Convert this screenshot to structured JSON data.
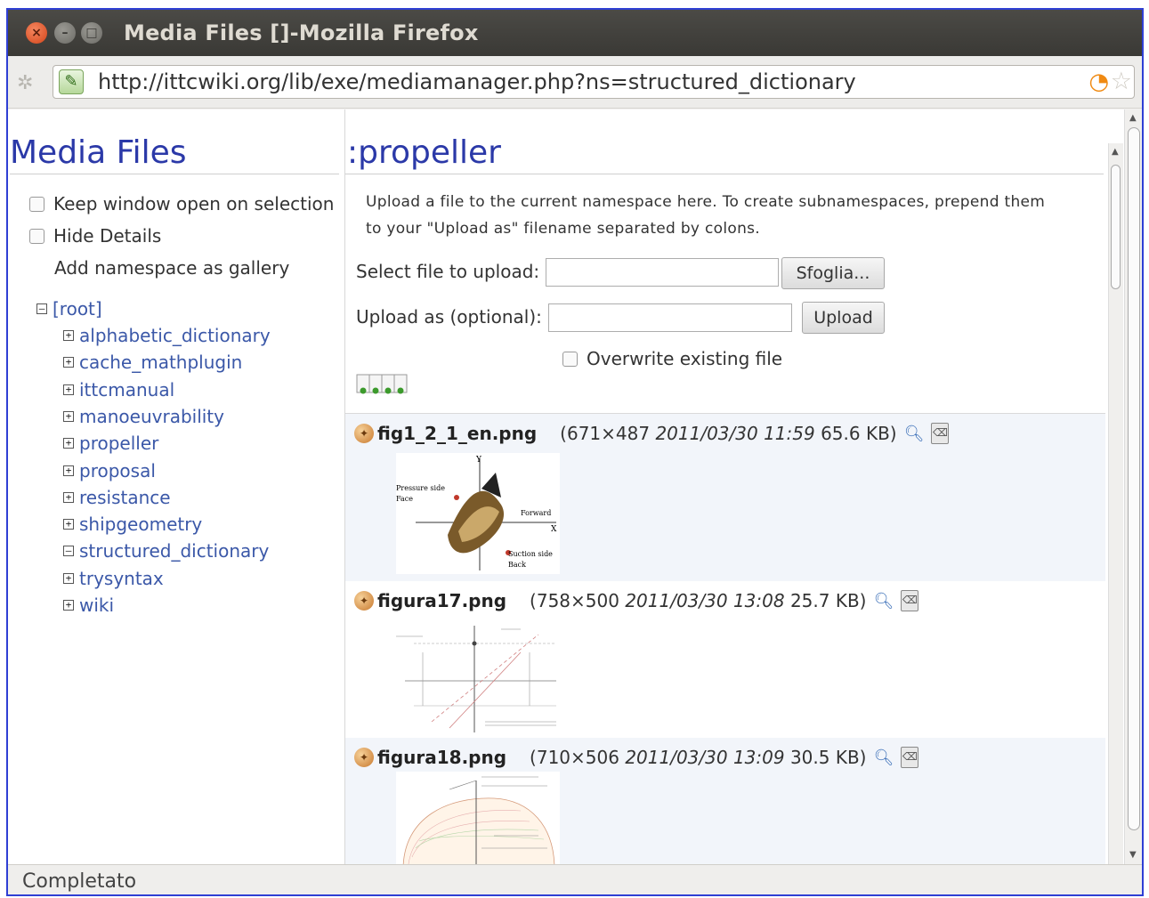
{
  "window": {
    "title": "Media Files []-Mozilla Firefox",
    "url": "http://ittcwiki.org/lib/exe/mediamanager.php?ns=structured_dictionary",
    "status": "Completato"
  },
  "left": {
    "title": "Media Files",
    "options": [
      "Keep window open on selection",
      "Hide Details"
    ],
    "gallery_label": "Add namespace as gallery",
    "tree_root": "[root]",
    "tree_items": [
      {
        "label": "alphabetic_dictionary",
        "expanded": false
      },
      {
        "label": "cache_mathplugin",
        "expanded": false
      },
      {
        "label": "ittcmanual",
        "expanded": false
      },
      {
        "label": "manoeuvrability",
        "expanded": false
      },
      {
        "label": "propeller",
        "expanded": false
      },
      {
        "label": "proposal",
        "expanded": false
      },
      {
        "label": "resistance",
        "expanded": false
      },
      {
        "label": "shipgeometry",
        "expanded": false
      },
      {
        "label": "structured_dictionary",
        "expanded": true
      },
      {
        "label": "trysyntax",
        "expanded": false
      },
      {
        "label": "wiki",
        "expanded": false
      }
    ]
  },
  "right": {
    "title": ":propeller",
    "info_line1": "Upload a file to the current namespace here. To create subnamespaces, prepend them",
    "info_line2": "to your \"Upload as\" filename separated by colons.",
    "select_label": "Select file to upload:",
    "browse_label": "Sfoglia...",
    "upload_as_label": "Upload as (optional):",
    "upload_button": "Upload",
    "overwrite_label": "Overwrite existing file",
    "files": [
      {
        "name": "fig1_2_1_en.png",
        "meta_pre": "(671×487 ",
        "date": "2011/03/30 11:59",
        "meta_post": " 65.6 KB)",
        "thumb_labels": [
          "Y",
          "Pressure side",
          "Face",
          "Forward",
          "X",
          "Suction side",
          "Back"
        ]
      },
      {
        "name": "figura17.png",
        "meta_pre": "(758×500 ",
        "date": "2011/03/30 13:08",
        "meta_post": " 25.7 KB)"
      },
      {
        "name": "figura18.png",
        "meta_pre": "(710×506 ",
        "date": "2011/03/30 13:09",
        "meta_post": " 30.5 KB)"
      }
    ]
  },
  "icons": {
    "close": "close-icon",
    "minimize": "minimize-icon",
    "maximize": "maximize-icon",
    "rss": "rss-icon",
    "bookmark": "star-icon",
    "zoom": "magnifier-icon",
    "delete": "trash-icon"
  },
  "colors": {
    "heading": "#2b39a8",
    "link": "#3b58a8",
    "border": "#2f3fd4"
  }
}
